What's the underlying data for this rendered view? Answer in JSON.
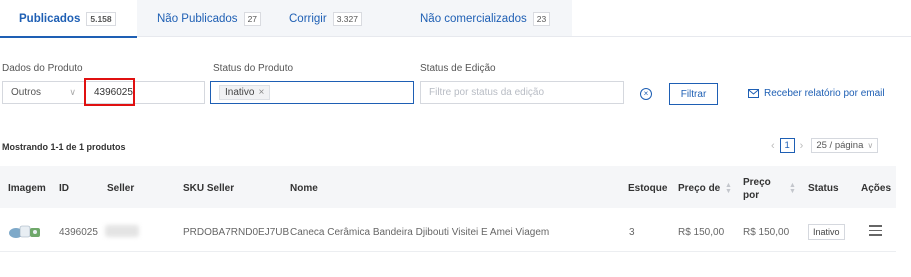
{
  "tabs": [
    {
      "label": "Publicados",
      "count": "5.158"
    },
    {
      "label": "Não Publicados",
      "count": "27"
    },
    {
      "label": "Corrigir",
      "count": "3.327"
    },
    {
      "label": "Não comercializados",
      "count": "23"
    }
  ],
  "filters": {
    "product_label": "Dados do Produto",
    "product_type": "Outros",
    "product_value": "4396025",
    "status_label": "Status do Produto",
    "status_tag": "Inativo",
    "edit_label": "Status de Edição",
    "edit_placeholder": "Filtre por status da edição",
    "filter_button": "Filtrar",
    "report_link": "Receber relatório por email"
  },
  "results": {
    "showing": "Mostrando 1-1 de 1 produtos",
    "current_page": "1",
    "page_size": "25 / página"
  },
  "table": {
    "headers": {
      "image": "Imagem",
      "id": "ID",
      "seller": "Seller",
      "sku": "SKU Seller",
      "name": "Nome",
      "stock": "Estoque",
      "price_from": "Preço de",
      "price_to": "Preço por",
      "status": "Status",
      "actions": "Ações"
    },
    "rows": [
      {
        "id": "4396025",
        "sku": "PRDOBA7RND0EJ7UB",
        "name": "Caneca Cerâmica Bandeira Djibouti Visitei E Amei Viagem",
        "stock": "3",
        "price_from": "R$ 150,00",
        "price_to": "R$ 150,00",
        "status": "Inativo"
      }
    ]
  },
  "colors": {
    "accent": "#1e5fb4",
    "highlight": "#e01010"
  }
}
